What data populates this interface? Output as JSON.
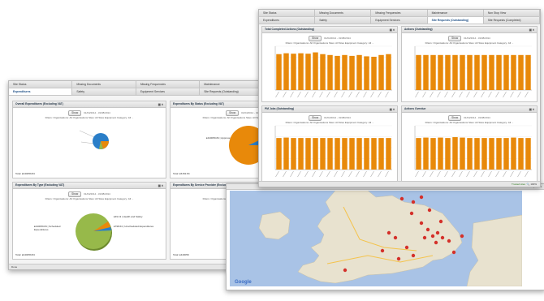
{
  "colors": {
    "accent": "#e8890a",
    "blue": "#2a7ec8",
    "green": "#97b94a",
    "tab_active": "#1d4f86"
  },
  "tabs_row1": [
    "Site Status",
    "Missing Documents",
    "Missing Frequencies",
    "Maintenance",
    "Non Stop View"
  ],
  "tabs_row2": [
    "Expenditures",
    "Safety",
    "Equipment Services",
    "Site Requests (Outstanding)",
    "Site Requests (Completed)"
  ],
  "back": {
    "panels": [
      {
        "title": "Overall Expenditures (Excluding VAT)",
        "total": "Total: £440059.84"
      },
      {
        "title": "Expenditures By Status (Excluding VAT)",
        "total": "Total: £6152.84",
        "label": "£440059.84 | Approved"
      },
      {
        "title": "Expenditures By Type (Excluding VAT)",
        "total": "Total: £440059.84",
        "label1": "£440059.84 | Scheduled Expenditures",
        "label2": "£49.13 | Health and Safety",
        "label3": "£798.64 | Unscheduled Expenditures"
      },
      {
        "title": "Expenditures By Service Provider (Excluding VAT)",
        "total": "Total: £440059"
      }
    ],
    "show_label": "Show",
    "date_range": "01/04/2014 - 31/08/2014",
    "filters": "Filters: Organisations: All Organisations Sites: All Sites Equipment Category: All ...",
    "status_left": "Done",
    "status_zone": "Trusted sites",
    "status_zoom": "100%"
  },
  "front": {
    "panels": [
      {
        "title": "Total Completed Actions (Outstanding)"
      },
      {
        "title": "Actions (Outstanding)"
      },
      {
        "title": "PM Jobs (Outstanding)"
      },
      {
        "title": "Actions Overdue"
      }
    ],
    "show_label": "Show",
    "date_range": "01/04/2014 - 31/08/2014",
    "filters": "Filters: Organisations: All Organisations Sites: All Sites Equipment Category: All ...",
    "status_zone": "Trusted sites",
    "status_zoom": "100%"
  },
  "map": {
    "google_label": "Google",
    "status_zone": "Trusted sites",
    "status_zoom": "100%"
  },
  "chart_data": [
    {
      "type": "bar",
      "title": "Total Completed Actions (Outstanding)",
      "ylim": [
        0,
        100
      ],
      "values": [
        82,
        84,
        83,
        84,
        83,
        86,
        82,
        80,
        78,
        80,
        78,
        80,
        77,
        76,
        80,
        82
      ]
    },
    {
      "type": "bar",
      "title": "Actions (Outstanding)",
      "ylim": [
        0,
        100
      ],
      "values": [
        80,
        80,
        80,
        80,
        80,
        80,
        80,
        80,
        80,
        80,
        80,
        80,
        80,
        80,
        80,
        80
      ]
    },
    {
      "type": "bar",
      "title": "PM Jobs (Outstanding)",
      "ylim": [
        0,
        100
      ],
      "values": [
        72,
        73,
        72,
        72,
        72,
        72,
        72,
        72,
        72,
        72,
        72,
        72,
        72,
        72,
        72,
        72
      ]
    },
    {
      "type": "bar",
      "title": "Actions Overdue",
      "ylim": [
        0,
        100
      ],
      "values": [
        72,
        73,
        72,
        73,
        72,
        74,
        73,
        72,
        72,
        72,
        72,
        72,
        72,
        73,
        72,
        72
      ]
    },
    {
      "type": "pie",
      "title": "Expenditures By Status (Excluding VAT)",
      "values": [
        96,
        4
      ]
    },
    {
      "type": "pie",
      "title": "Expenditures By Type (Excluding VAT)",
      "values": [
        90,
        6,
        4
      ]
    }
  ]
}
